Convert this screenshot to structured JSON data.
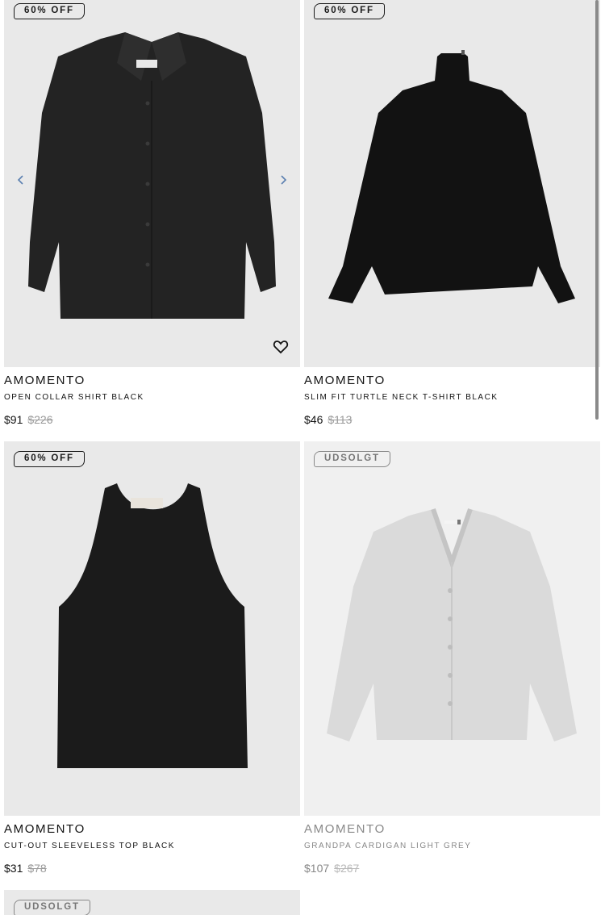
{
  "products": [
    {
      "badge": "60% OFF",
      "brand": "AMOMENTO",
      "name": "OPEN COLLAR SHIRT BLACK",
      "price": "$91",
      "original_price": "$226",
      "garment": "shirt",
      "color": "#252525"
    },
    {
      "badge": "60% OFF",
      "brand": "AMOMENTO",
      "name": "SLIM FIT TURTLE NECK T-SHIRT BLACK",
      "price": "$46",
      "original_price": "$113",
      "garment": "turtleneck",
      "color": "#111111"
    },
    {
      "badge": "60% OFF",
      "brand": "AMOMENTO",
      "name": "CUT-OUT SLEEVELESS TOP BLACK",
      "price": "$31",
      "original_price": "$78",
      "garment": "tank-top",
      "color": "#1b1b1b"
    },
    {
      "badge": "UDSOLGT",
      "brand": "AMOMENTO",
      "name": "GRANDPA CARDIGAN LIGHT GREY",
      "price": "$107",
      "original_price": "$267",
      "garment": "cardigan",
      "color": "#d9d9d9"
    },
    {
      "badge": "UDSOLGT"
    }
  ],
  "icons": {
    "carousel_prev": "chevron-left-icon",
    "carousel_next": "chevron-right-icon",
    "wishlist": "heart-icon"
  },
  "colors": {
    "arrow": "#5a7fb0",
    "image_bg": "#e9e9e9"
  }
}
